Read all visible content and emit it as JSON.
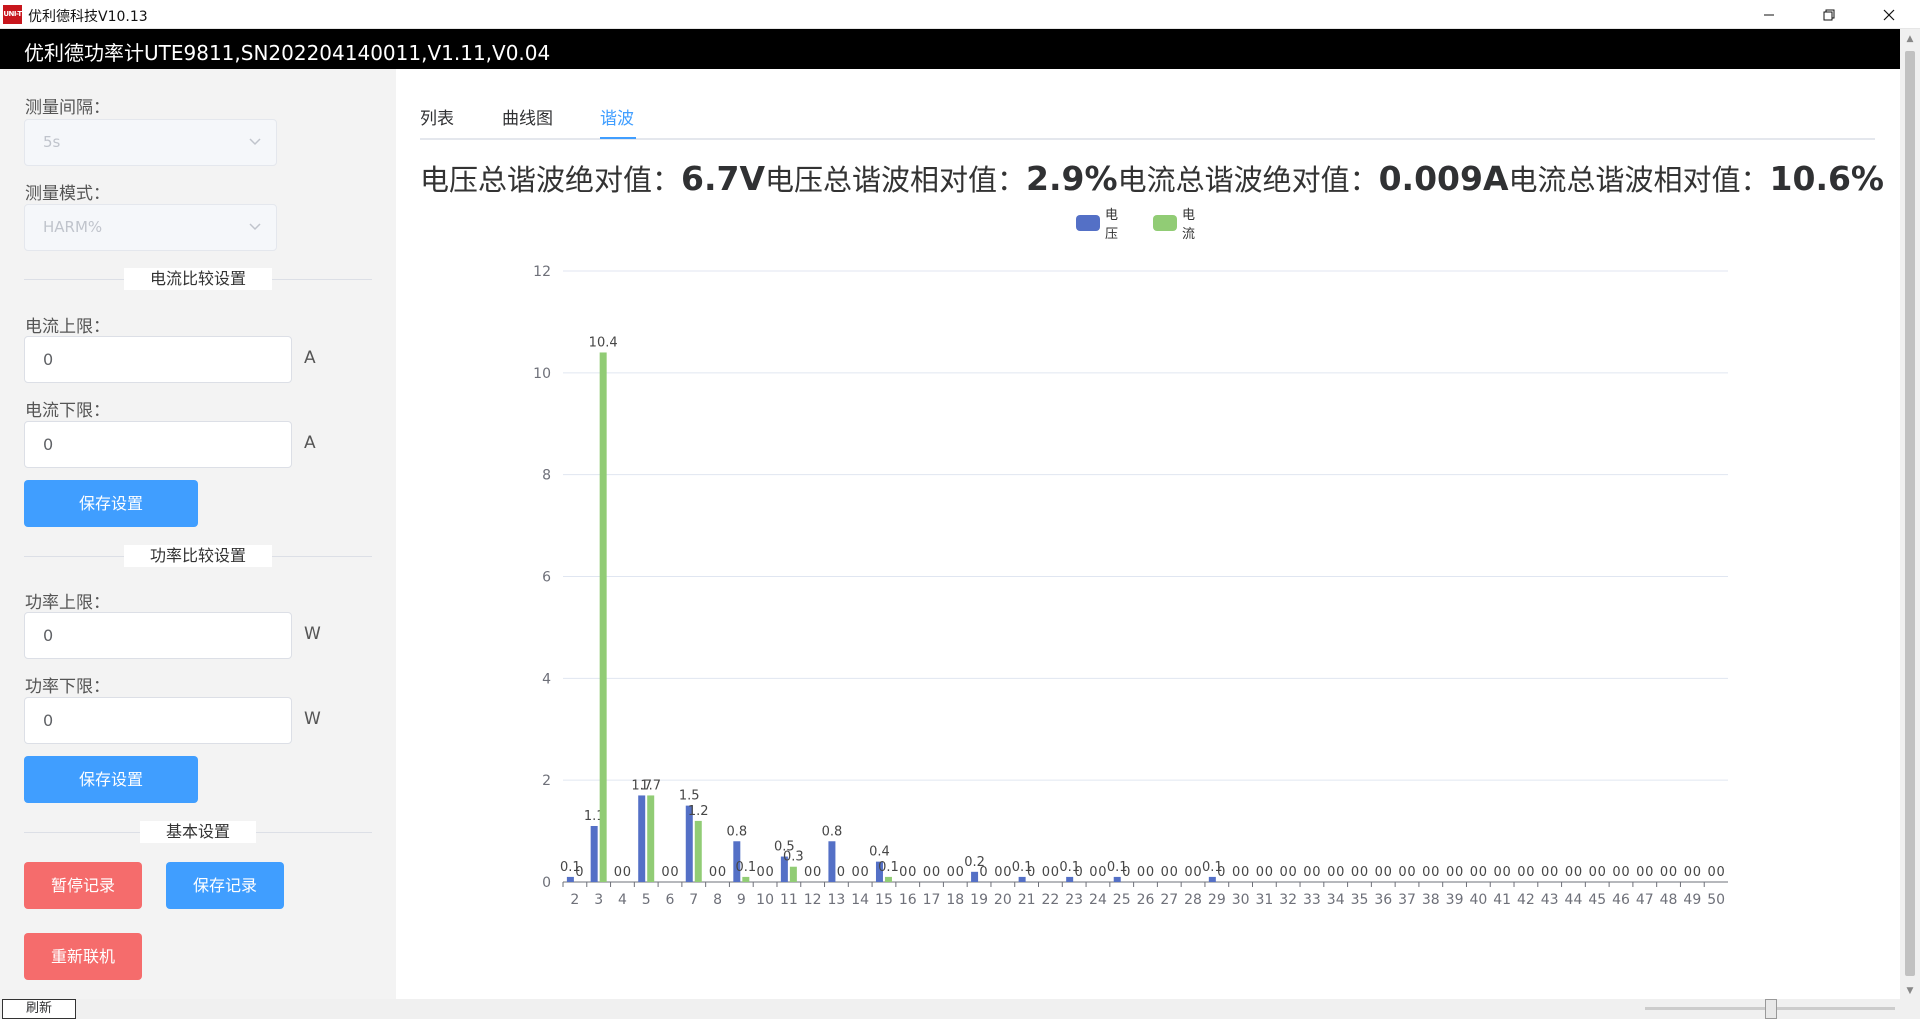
{
  "window": {
    "icon_text": "UNI-T",
    "title": "优利德科技V10.13"
  },
  "header": {
    "title": "优利德功率计UTE9811,SN202204140011,V1.11,V0.04"
  },
  "sidebar": {
    "interval_label": "测量间隔：",
    "interval_value": "5s",
    "mode_label": "测量模式：",
    "mode_value": "HARM%",
    "current_section": "电流比较设置",
    "current_upper_label": "电流上限：",
    "current_upper_value": "0",
    "current_lower_label": "电流下限：",
    "current_lower_value": "0",
    "current_unit": "A",
    "save_settings_1": "保存设置",
    "power_section": "功率比较设置",
    "power_upper_label": "功率上限：",
    "power_upper_value": "0",
    "power_lower_label": "功率下限：",
    "power_lower_value": "0",
    "power_unit": "W",
    "save_settings_2": "保存设置",
    "basic_section": "基本设置",
    "pause_record": "暂停记录",
    "save_record": "保存记录",
    "reconnect": "重新联机"
  },
  "tabs": [
    "列表",
    "曲线图",
    "谐波"
  ],
  "active_tab": "谐波",
  "summary": {
    "v_abs_label": "电压总谐波绝对值：",
    "v_abs_value": "6.7V",
    "v_rel_label": "电压总谐波相对值：",
    "v_rel_value": "2.9%",
    "i_abs_label": "电流总谐波绝对值：",
    "i_abs_value": "0.009A",
    "i_rel_label": "电流总谐波相对值：",
    "i_rel_value": "10.6%"
  },
  "colors": {
    "voltage": "#5470c6",
    "current": "#91cc75",
    "accent": "#409eff",
    "danger": "#f56c6c"
  },
  "statusbar": {
    "refresh": "刷新"
  },
  "chart_data": {
    "type": "bar",
    "categories": [
      "2",
      "3",
      "4",
      "5",
      "6",
      "7",
      "8",
      "9",
      "10",
      "11",
      "12",
      "13",
      "14",
      "15",
      "16",
      "17",
      "18",
      "19",
      "20",
      "21",
      "22",
      "23",
      "24",
      "25",
      "26",
      "27",
      "28",
      "29",
      "30",
      "31",
      "32",
      "33",
      "34",
      "35",
      "36",
      "37",
      "38",
      "39",
      "40",
      "41",
      "42",
      "43",
      "44",
      "45",
      "46",
      "47",
      "48",
      "49",
      "50"
    ],
    "series": [
      {
        "name": "电压",
        "values": [
          0.1,
          1.1,
          0,
          1.7,
          0,
          1.5,
          0,
          0.8,
          0,
          0.5,
          0,
          0.8,
          0,
          0.4,
          0,
          0,
          0,
          0.2,
          0,
          0.1,
          0,
          0.1,
          0,
          0.1,
          0,
          0,
          0,
          0.1,
          0,
          0,
          0,
          0,
          0,
          0,
          0,
          0,
          0,
          0,
          0,
          0,
          0,
          0,
          0,
          0,
          0,
          0,
          0,
          0,
          0
        ]
      },
      {
        "name": "电流",
        "values": [
          0,
          10.4,
          0,
          1.7,
          0,
          1.2,
          0,
          0.1,
          0,
          0.3,
          0,
          0,
          0,
          0.1,
          0,
          0,
          0,
          0,
          0,
          0,
          0,
          0,
          0,
          0,
          0,
          0,
          0,
          0,
          0,
          0,
          0,
          0,
          0,
          0,
          0,
          0,
          0,
          0,
          0,
          0,
          0,
          0,
          0,
          0,
          0,
          0,
          0,
          0,
          0
        ]
      }
    ],
    "ylim": [
      0,
      12
    ],
    "yticks": [
      0,
      2,
      4,
      6,
      8,
      10,
      12
    ],
    "grid": true,
    "legend": "top-center"
  }
}
